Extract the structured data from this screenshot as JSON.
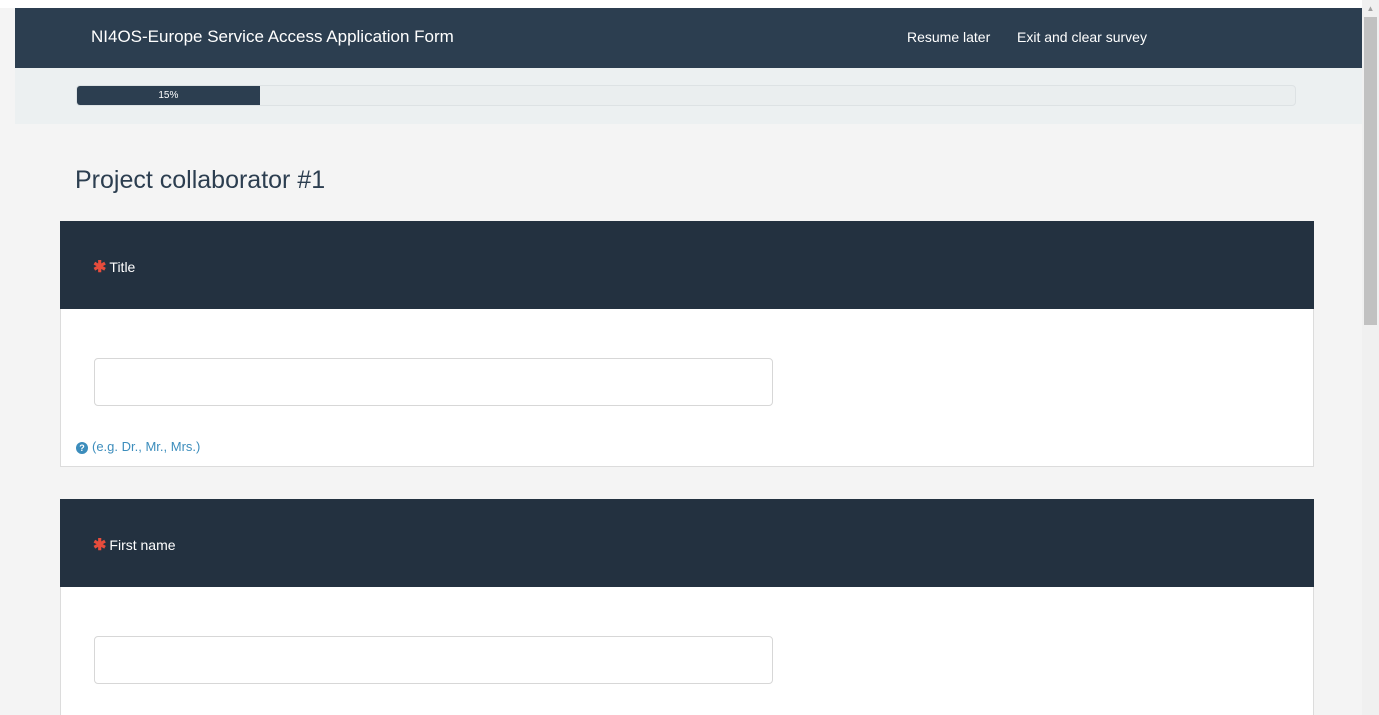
{
  "header": {
    "title": "NI4OS-Europe Service Access Application Form",
    "links": {
      "resume": "Resume later",
      "exit": "Exit and clear survey"
    }
  },
  "progress": {
    "percent": 15,
    "label": "15%"
  },
  "group": {
    "title": "Project collaborator #1"
  },
  "questions": [
    {
      "required_mark": "✱",
      "label": "Title",
      "value": "",
      "help": "(e.g. Dr., Mr., Mrs.)"
    },
    {
      "required_mark": "✱",
      "label": "First name",
      "value": ""
    }
  ],
  "colors": {
    "navbar": "#2c3e50",
    "question_header": "#233140",
    "required": "#e74c3c",
    "help": "#3c8dbc"
  },
  "icons": {
    "help": "question-circle",
    "required": "asterisk",
    "scroll_up": "arrow-up"
  }
}
